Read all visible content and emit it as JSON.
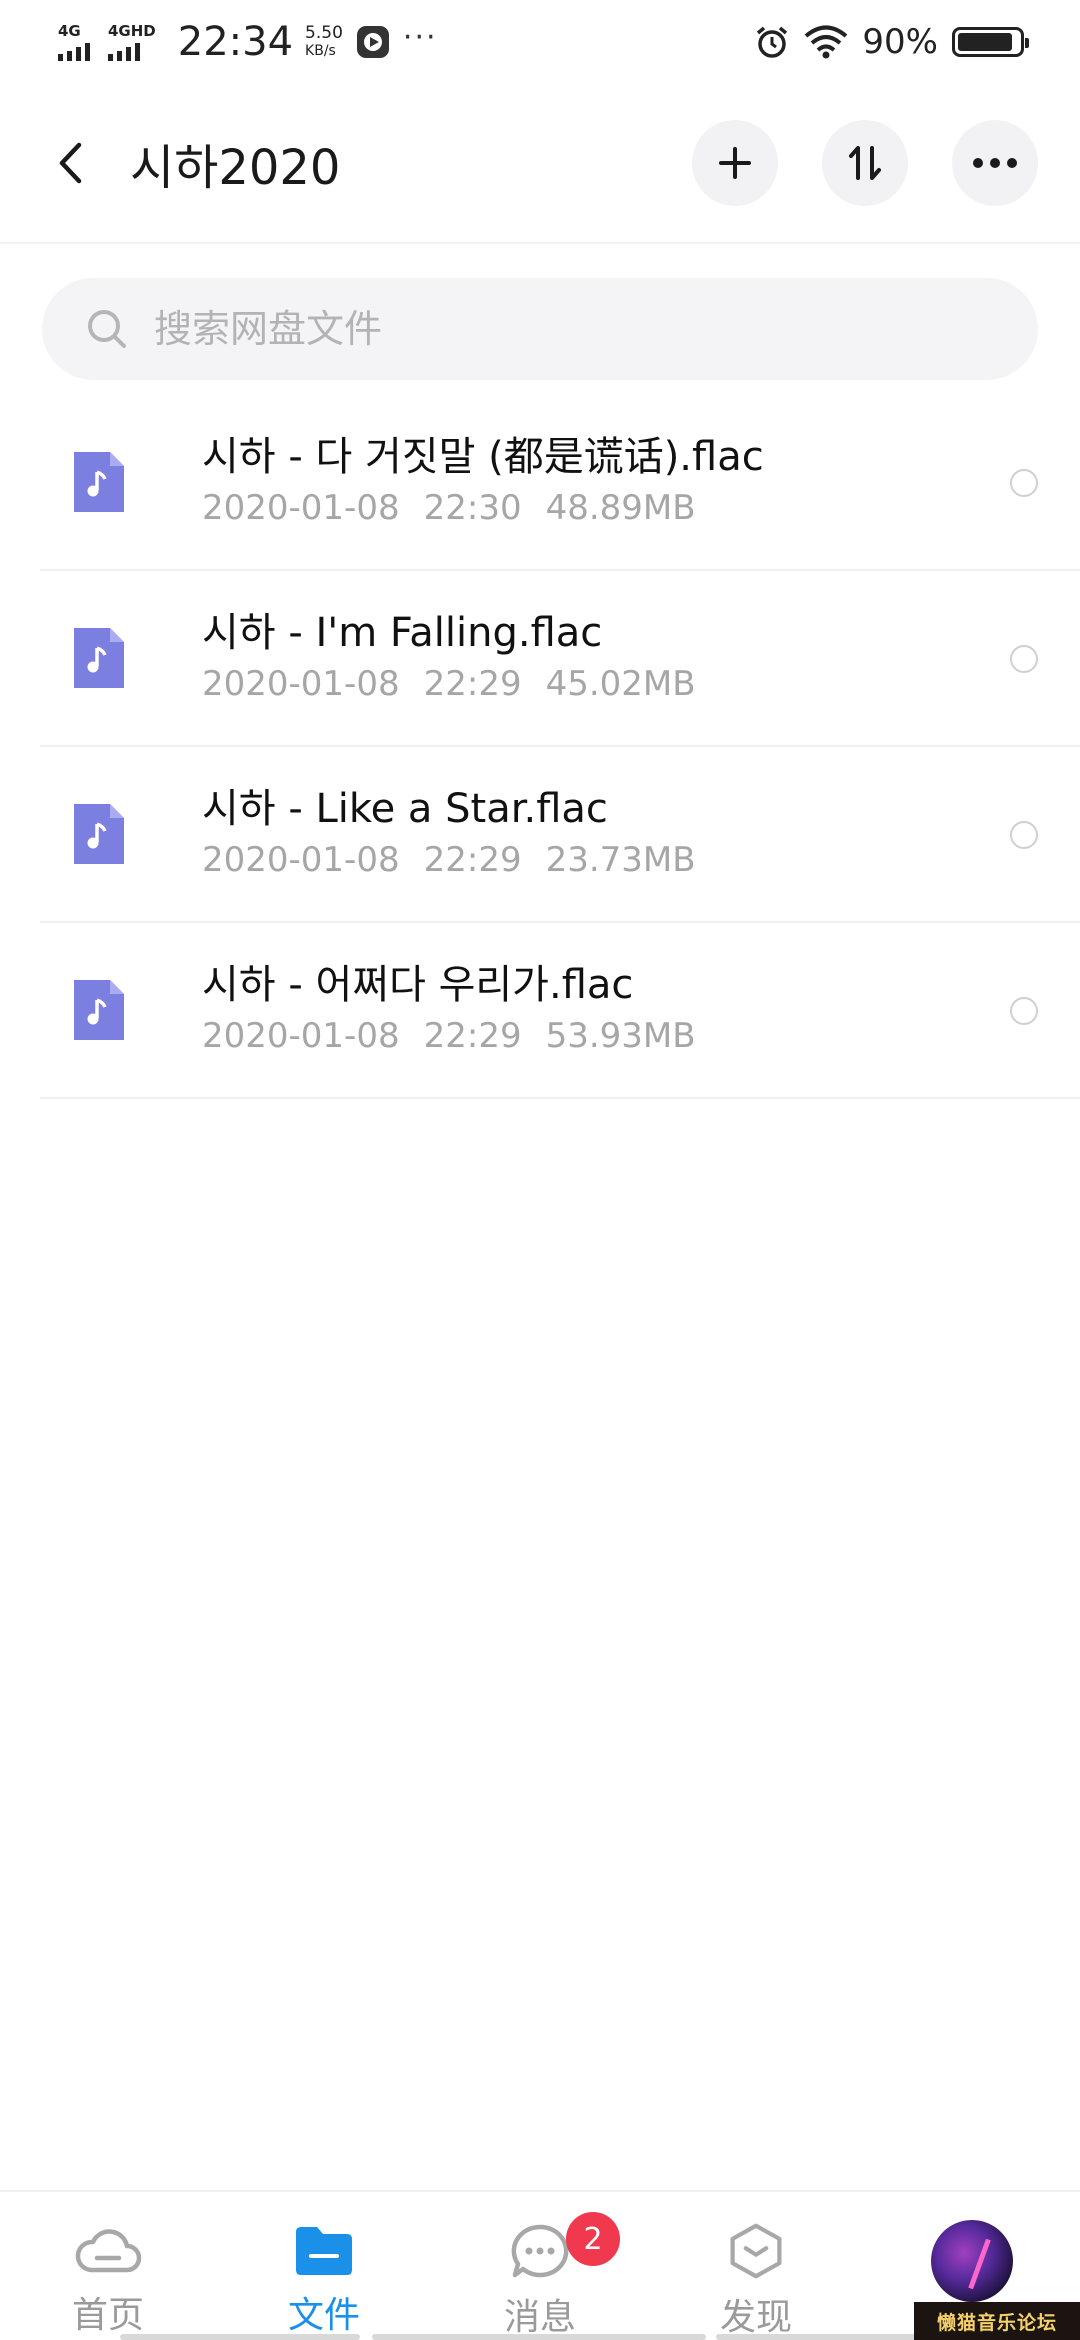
{
  "status_bar": {
    "network1": "4G",
    "network2": "4GHD",
    "time": "22:34",
    "speed_value": "5.50",
    "speed_unit": "KB/s",
    "more": "···",
    "battery_percent": "90%",
    "battery_level": 0.9
  },
  "header": {
    "title": "시하2020"
  },
  "search": {
    "placeholder": "搜索网盘文件"
  },
  "files": [
    {
      "name": "시하 - 다 거짓말 (都是谎话).flac",
      "date": "2020-01-08",
      "time": "22:30",
      "size": "48.89MB"
    },
    {
      "name": "시하 - I'm Falling.flac",
      "date": "2020-01-08",
      "time": "22:29",
      "size": "45.02MB"
    },
    {
      "name": "시하 - Like a Star.flac",
      "date": "2020-01-08",
      "time": "22:29",
      "size": "23.73MB"
    },
    {
      "name": "시하 - 어쩌다 우리가.flac",
      "date": "2020-01-08",
      "time": "22:29",
      "size": "53.93MB"
    }
  ],
  "bottom_nav": {
    "items": [
      {
        "label": "首页",
        "icon": "cloud-icon"
      },
      {
        "label": "文件",
        "icon": "folder-icon",
        "active": true
      },
      {
        "label": "消息",
        "icon": "chat-icon",
        "badge": "2"
      },
      {
        "label": "发现",
        "icon": "discover-icon"
      }
    ]
  },
  "watermark": "懒猫音乐论坛",
  "colors": {
    "accent": "#1a90e8",
    "file_icon": "#7b7fe0",
    "badge": "#f0394e"
  }
}
